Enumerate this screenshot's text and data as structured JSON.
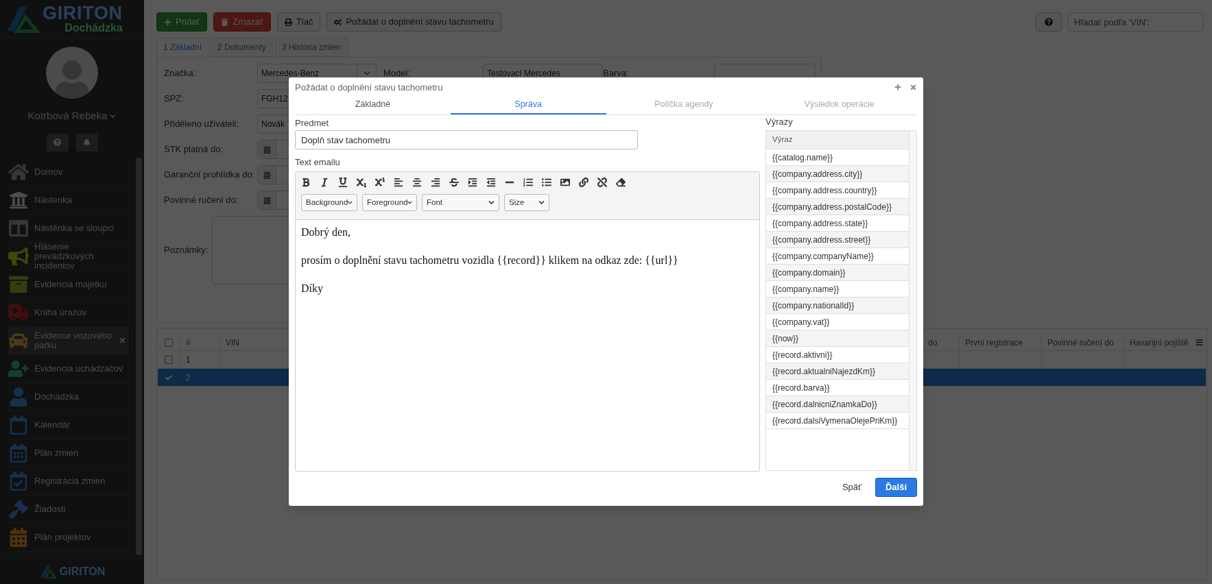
{
  "sidebar": {
    "logo": {
      "title": "GIRITON",
      "subtitle": "Dochádzka"
    },
    "user": {
      "name": "Kotrbová Rebeka"
    },
    "items": [
      {
        "label": "Domov",
        "selected": false
      },
      {
        "label": "Nástenka",
        "selected": false
      },
      {
        "label": "Nástěnka se sloupci",
        "selected": false
      },
      {
        "label": "Hlásenie prevádzkových incidentov",
        "selected": false
      },
      {
        "label": "Evidencia majetku",
        "selected": false
      },
      {
        "label": "Kniha úrazov",
        "selected": false
      },
      {
        "label": "Evidence vozového parku",
        "selected": true
      },
      {
        "label": "Evidencia uchádzačov",
        "selected": false
      },
      {
        "label": "Dochádzka",
        "selected": false
      },
      {
        "label": "Kalendár",
        "selected": false
      },
      {
        "label": "Plán zmien",
        "selected": false
      },
      {
        "label": "Registrácia zmien",
        "selected": false
      },
      {
        "label": "Žiadosti",
        "selected": false
      },
      {
        "label": "Plán projektov",
        "selected": false
      }
    ],
    "footer_logo": "GIRITON"
  },
  "toolbar": {
    "buttons": [
      {
        "label": "Pridať",
        "kind": "add"
      },
      {
        "label": "Zmazať",
        "kind": "delete"
      },
      {
        "label": "Tlač",
        "kind": "print"
      },
      {
        "label": "Požádat o doplnění stavu tachometru",
        "kind": "action"
      }
    ],
    "search": {
      "placeholder": "Hľadať podľa 'VIN':"
    }
  },
  "tabs": [
    {
      "label": "1 Základní",
      "selected": true
    },
    {
      "label": "2 Dokumenty",
      "selected": false
    },
    {
      "label": "3 História zmien",
      "selected": false
    }
  ],
  "form": {
    "rows": [
      {
        "fields": [
          {
            "label": "Značka:",
            "kind": "select",
            "value": "Mercedes-Benz"
          },
          {
            "label": "Model:",
            "kind": "text",
            "value": "Testovací Mercedes"
          },
          {
            "label": "Barva:",
            "kind": "text"
          }
        ]
      },
      {
        "fields": [
          {
            "label": "SPZ:",
            "kind": "text",
            "value": "FGH12"
          }
        ]
      },
      {
        "fields": [
          {
            "label": "Přiděleno uživateli:",
            "kind": "select",
            "value": "Novák"
          }
        ]
      },
      {
        "fields": [
          {
            "label": "STK platná do:",
            "kind": "date"
          }
        ]
      },
      {
        "fields": [
          {
            "label": "Garanční prohlídka do:",
            "kind": "date"
          }
        ]
      },
      {
        "fields": [
          {
            "label": "Povinné ručení do:",
            "kind": "date"
          }
        ]
      },
      {
        "fields": [
          {
            "label": "Poznámky:",
            "kind": "textarea"
          }
        ]
      }
    ]
  },
  "table": {
    "all_checked": false,
    "columns": [
      "#",
      "VIN",
      "do",
      "První registrace",
      "Povinné ručení do",
      "Havarijní pojiště"
    ],
    "rows": [
      {
        "cells": [
          "1"
        ],
        "selected": false
      },
      {
        "cells": [
          "2"
        ],
        "selected": true
      }
    ]
  },
  "modal": {
    "title": "Požádat o doplnění stavu tachometru",
    "tabs": [
      {
        "label": "Základné",
        "selected": false,
        "disabled": false
      },
      {
        "label": "Správa",
        "selected": true,
        "disabled": false
      },
      {
        "label": "Políčka agendy",
        "selected": false,
        "disabled": true
      },
      {
        "label": "Výsledok operácie",
        "selected": false,
        "disabled": true
      }
    ],
    "subject": {
      "label": "Predmet",
      "value": "Doplň stav tachometru"
    },
    "body": {
      "label": "Text emailu",
      "selects": [
        "Background",
        "Foreground",
        "Font",
        "Size"
      ],
      "paragraphs": [
        "Dobrý den,",
        "prosím o doplnění stavu tachometru vozidla {{record}} klikem na odkaz zde: {{url}}",
        "Díky"
      ]
    },
    "expressions": {
      "label": "Výrazy",
      "column": "Výraz",
      "rows": [
        "{{catalog.name}}",
        "{{company.address.city}}",
        "{{company.address.country}}",
        "{{company.address.postalCode}}",
        "{{company.address.state}}",
        "{{company.address.street}}",
        "{{company.companyName}}",
        "{{company.domain}}",
        "{{company.name}}",
        "{{company.nationalId}}",
        "{{company.vat}}",
        "{{now}}",
        "{{record.aktivni}}",
        "{{record.aktualniNajezdKm}}",
        "{{record.barva}}",
        "{{record.dalnicniZnamkaDo}}",
        "{{record.dalsiVymenaOlejePriKm}}"
      ]
    },
    "footer": {
      "back": "Späť",
      "next": "Ďalší"
    }
  }
}
